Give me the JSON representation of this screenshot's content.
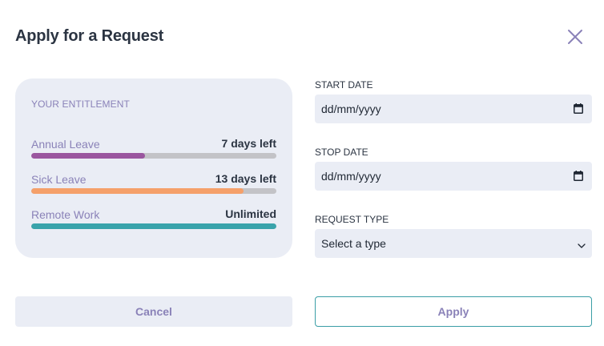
{
  "dialog": {
    "title": "Apply for a Request",
    "close_icon": "close-icon"
  },
  "entitlement": {
    "heading": "YOUR ENTITLEMENT",
    "items": [
      {
        "label": "Annual Leave",
        "value": "7 days left",
        "fill": 0.465,
        "color": "#9a569f"
      },
      {
        "label": "Sick Leave",
        "value": "13 days left",
        "fill": 0.865,
        "color": "#f5a06a"
      },
      {
        "label": "Remote Work",
        "value": "Unlimited",
        "fill": 1.0,
        "color": "#39a3ab"
      }
    ]
  },
  "form": {
    "start_date": {
      "label": "START DATE",
      "value": "dd/mm/yyyy",
      "icon": "calendar-icon"
    },
    "stop_date": {
      "label": "STOP DATE",
      "value": "dd/mm/yyyy",
      "icon": "calendar-icon"
    },
    "request_type": {
      "label": "REQUEST TYPE",
      "value": "Select a type",
      "icon": "chevron-down-icon"
    }
  },
  "actions": {
    "cancel_label": "Cancel",
    "apply_label": "Apply"
  },
  "colors": {
    "accent": "#8a82b8",
    "teal": "#3a9ea6",
    "panel": "#eaedf5"
  }
}
